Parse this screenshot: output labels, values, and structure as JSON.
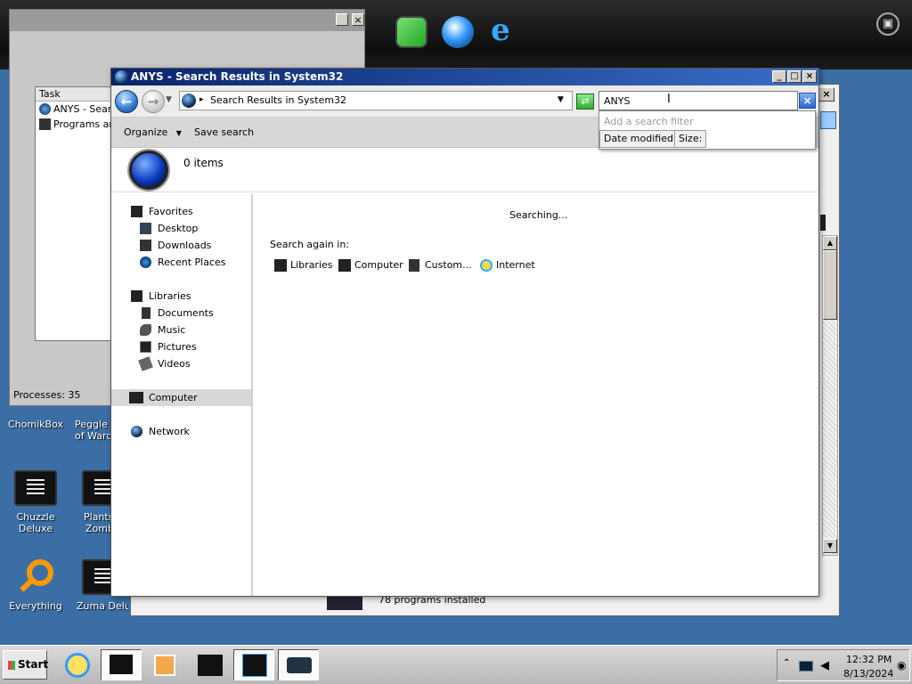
{
  "background_window": {
    "column_task": "Task",
    "rows": [
      "ANYS - Searc",
      "Programs and"
    ],
    "status": "Processes: 35"
  },
  "desktop_icons": [
    "ChomikBox",
    "Peggle W",
    "of Ward",
    "Chuzzle Deluxe",
    "Plants",
    "Zomb",
    "Everything",
    "Zuma Delux"
  ],
  "right_window": {
    "footer_text": "78 programs installed"
  },
  "window": {
    "title": "ANYS - Search Results in System32",
    "address": "Search Results in System32",
    "toolbar": {
      "organize": "Organize",
      "save_search": "Save search"
    },
    "details": {
      "items": "0 items"
    },
    "search": {
      "query": "ANYS",
      "filter_hint": "Add a search filter",
      "filters": [
        "Date modified:",
        "Size:"
      ]
    },
    "nav": {
      "favorites": "Favorites",
      "desktop": "Desktop",
      "downloads": "Downloads",
      "recent": "Recent Places",
      "libraries": "Libraries",
      "documents": "Documents",
      "music": "Music",
      "pictures": "Pictures",
      "videos": "Videos",
      "computer": "Computer",
      "network": "Network"
    },
    "content": {
      "status": "Searching...",
      "search_again": "Search again in:",
      "scopes": [
        "Libraries",
        "Computer",
        "Custom...",
        "Internet"
      ]
    }
  },
  "taskbar": {
    "start": "Start",
    "time": "12:32 PM",
    "date": "8/13/2024"
  },
  "colors": {
    "titlebar_start": "#0a246a",
    "titlebar_end": "#3a6ec8",
    "desktop": "#3a6ea5"
  }
}
